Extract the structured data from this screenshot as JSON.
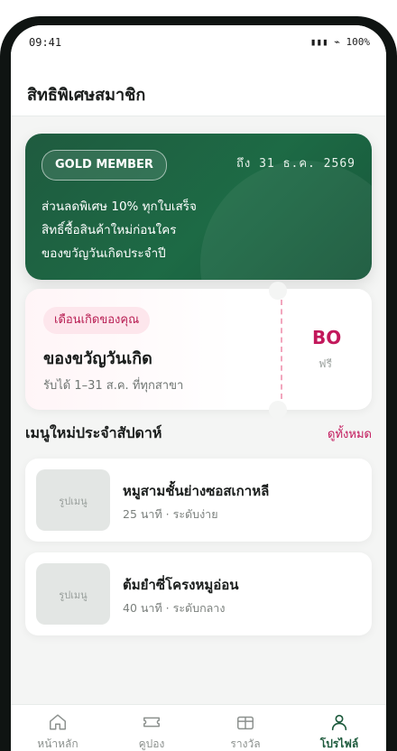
{
  "status": {
    "time": "09:41",
    "indicators": "▮▮▮ ⌁ 100%"
  },
  "header": {
    "title": "สิทธิพิเศษสมาชิก"
  },
  "member_card": {
    "tier": "GOLD MEMBER",
    "expiry": "ถึง 31 ธ.ค. 2569",
    "perks": [
      "ส่วนลดพิเศษ 10% ทุกใบเสร็จ",
      "สิทธิ์ซื้อสินค้าใหม่ก่อนใคร",
      "ของขวัญวันเกิดประจำปี"
    ],
    "colors": {
      "card": "#1d6a45"
    }
  },
  "birthday": {
    "pill": "เดือนเกิดของคุณ",
    "title": "ของขวัญวันเกิด",
    "subtitle": "รับได้ 1–31 ส.ค. ที่ทุกสาขา",
    "code": "BO",
    "free_label": "ฟรี",
    "colors": {
      "accent": "#c2185b"
    }
  },
  "menu_section": {
    "title": "เมนูใหม่ประจำสัปดาห์",
    "link": "ดูทั้งหมด",
    "items": [
      {
        "image_label": "รูปเมนู",
        "name": "หมูสามชั้นย่างซอสเกาหลี",
        "meta": "25 นาที · ระดับง่าย"
      },
      {
        "image_label": "รูปเมนู",
        "name": "ต้มยำซี่โครงหมูอ่อน",
        "meta": "40 นาที · ระดับกลาง"
      }
    ]
  },
  "nav": {
    "items": [
      {
        "label": "หน้าหลัก",
        "icon": "home-icon"
      },
      {
        "label": "คูปอง",
        "icon": "ticket-icon"
      },
      {
        "label": "รางวัล",
        "icon": "gift-icon"
      },
      {
        "label": "โปรไฟล์",
        "icon": "user-icon"
      }
    ],
    "active_index": 3,
    "colors": {
      "active": "#1d5a3c",
      "inactive": "#8c918e"
    }
  }
}
